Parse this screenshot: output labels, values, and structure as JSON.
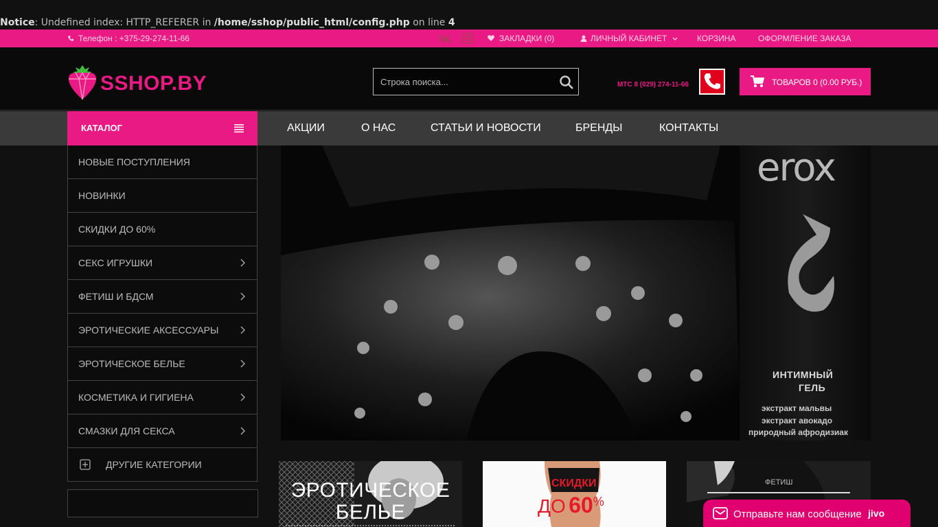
{
  "notice": {
    "label": "Notice",
    "message": ": Undefined index: HTTP_REFERER in ",
    "path": "/home/sshop/public_html/config.php",
    "online": " on line ",
    "line": "4"
  },
  "topbar": {
    "phone": "Телефон : +375-29-274-11-66",
    "bookmarks": "ЗАКЛАДКИ (0)",
    "account": "ЛИЧНЫЙ КАБИНЕТ",
    "cart": "КОРЗИНА",
    "checkout": "ОФОРМЛЕНИЕ ЗАКАЗА"
  },
  "header": {
    "logo": "SSHOP.BY",
    "search_placeholder": "Строка поиска...",
    "mts": "МТС 8 (029) 274-11-66",
    "cart_label": "ТОВАРОВ 0 (0.00 РУБ.)"
  },
  "nav": {
    "catalog": "КАТАЛОГ",
    "items": [
      "АКЦИИ",
      "О НАС",
      "СТАТЬИ И НОВОСТИ",
      "БРЕНДЫ",
      "КОНТАКТЫ"
    ]
  },
  "sidebar": {
    "items": [
      {
        "label": "НОВЫЕ ПОСТУПЛЕНИЯ",
        "chevron": false
      },
      {
        "label": "НОВИНКИ",
        "chevron": false
      },
      {
        "label": "СКИДКИ ДО 60%",
        "chevron": false
      },
      {
        "label": "СЕКС ИГРУШКИ",
        "chevron": true
      },
      {
        "label": "ФЕТИШ И БДСМ",
        "chevron": true
      },
      {
        "label": "ЭРОТИЧЕСКИЕ АКСЕССУАРЫ",
        "chevron": true
      },
      {
        "label": "ЭРОТИЧЕСКОЕ БЕЛЬЕ",
        "chevron": true
      },
      {
        "label": "КОСМЕТИКА И ГИГИЕНА",
        "chevron": true
      },
      {
        "label": "СМАЗКИ ДЛЯ СЕКСА",
        "chevron": true
      }
    ],
    "other": "ДРУГИЕ КАТЕГОРИИ"
  },
  "banner": {
    "brand": "erox",
    "line1": "ИНТИМНЫЙ",
    "line2": "ГЕЛЬ",
    "line3": "экстракт мальвы",
    "line4": "экстракт авокадо",
    "line5": "природный афродизиак"
  },
  "promos": {
    "lingerie_line1": "ЭРОТИЧЕСКОЕ",
    "lingerie_line2": "БЕЛЬЕ",
    "discount_title": "СКИДКИ",
    "discount_prefix": "ДО",
    "discount_value": "60",
    "discount_percent": "%",
    "fetish": "ФЕТИШ"
  },
  "jivo": {
    "text": "Отправьте нам сообщение",
    "logo": "jivo"
  },
  "colors": {
    "accent": "#ea1a84",
    "nav_bg": "#3a3a3a",
    "call_red": "#e0001b"
  }
}
